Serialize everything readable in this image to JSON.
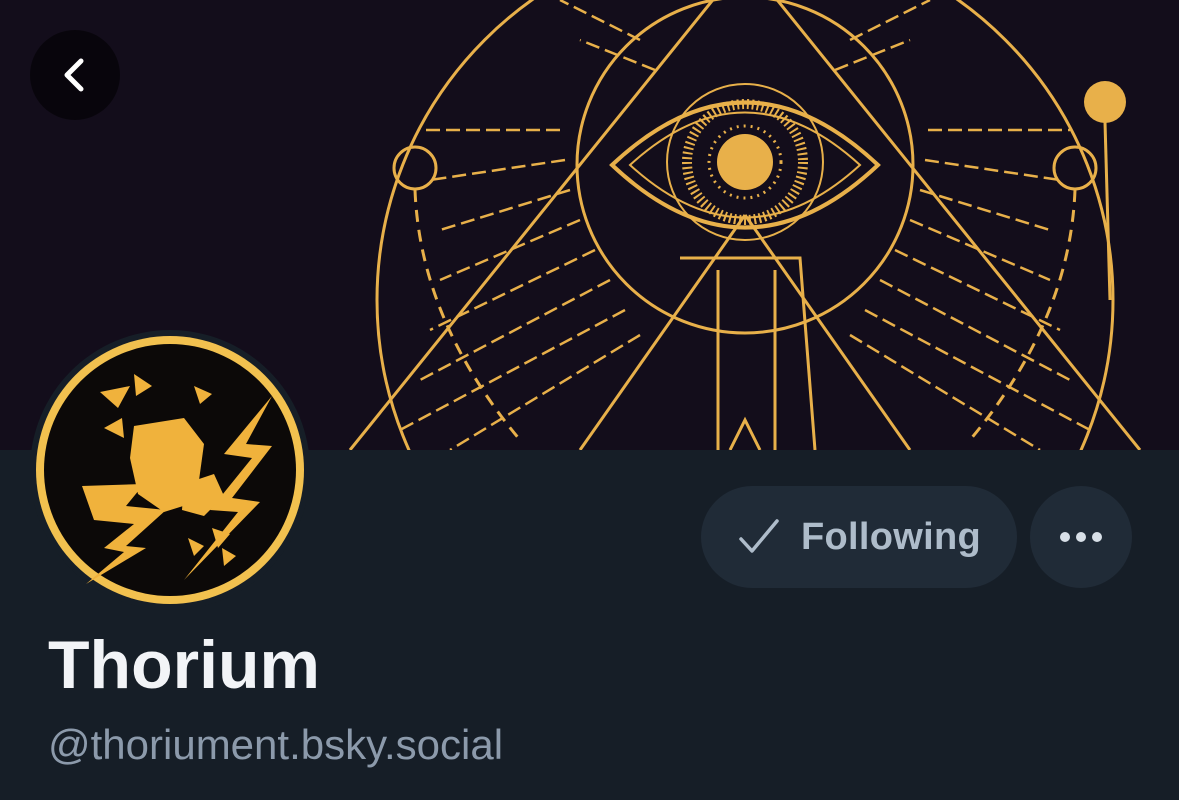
{
  "profile": {
    "display_name": "Thorium",
    "handle": "@thoriument.bsky.social"
  },
  "actions": {
    "following_label": "Following",
    "follow_icon": "check-icon",
    "more_icon": "ellipsis-icon",
    "back_icon": "chevron-left-icon"
  },
  "colors": {
    "banner_background": "#130d1b",
    "banner_gold": "#e8b04a",
    "page_background": "#161e27",
    "button_background": "#202b37",
    "button_text": "#aebcca",
    "display_name": "#f2f4f7",
    "handle": "#8c9aab"
  }
}
